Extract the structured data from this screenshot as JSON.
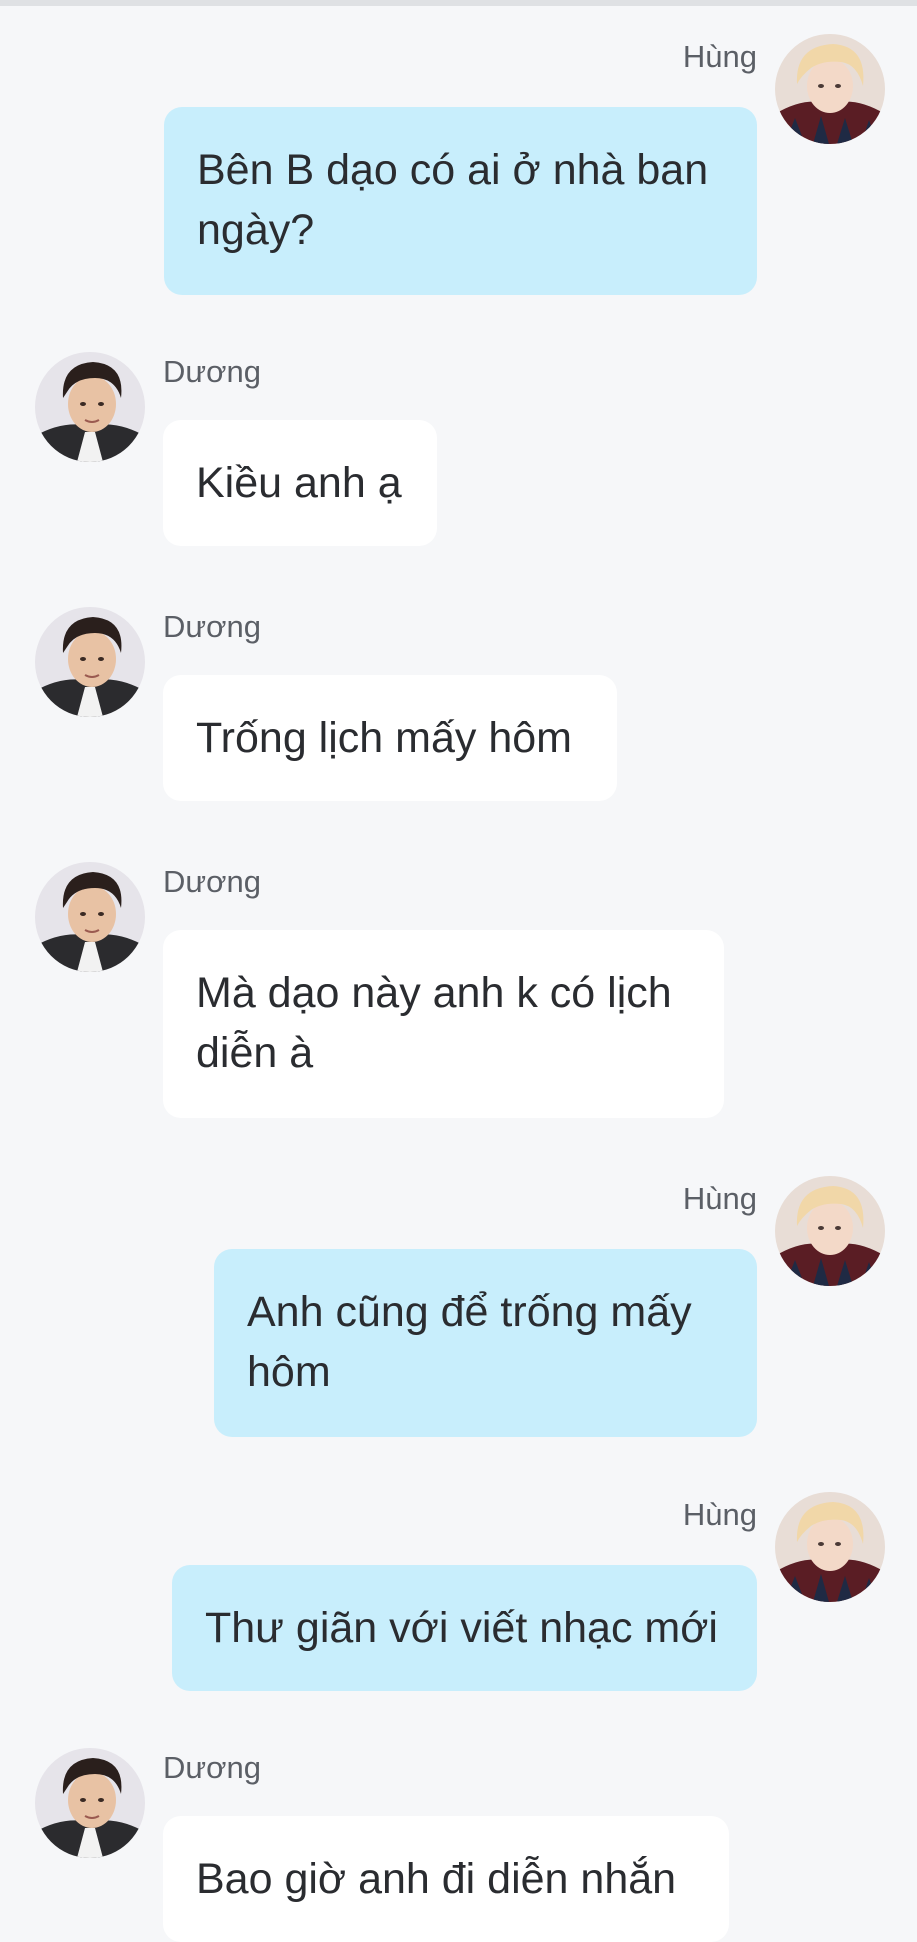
{
  "messages": [
    {
      "sender": "Hùng",
      "text": "Bên B dạo có ai ở nhà ban ngày?",
      "direction": "out"
    },
    {
      "sender": "Dương",
      "text": "Kiều anh ạ",
      "direction": "in"
    },
    {
      "sender": "Dương",
      "text": "Trống lịch mấy hôm",
      "direction": "in"
    },
    {
      "sender": "Dương",
      "text": "Mà dạo này anh k có lịch diễn à",
      "direction": "in"
    },
    {
      "sender": "Hùng",
      "text": "Anh cũng để trống mấy hôm",
      "direction": "out"
    },
    {
      "sender": "Hùng",
      "text": "Thư giãn với viết nhạc mới",
      "direction": "out"
    },
    {
      "sender": "Dương",
      "text": "Bao giờ anh đi diễn nhắn",
      "direction": "in"
    }
  ],
  "colors": {
    "outgoing_bubble": "#c8eefc",
    "incoming_bubble": "#ffffff",
    "background": "#f6f7f9"
  }
}
